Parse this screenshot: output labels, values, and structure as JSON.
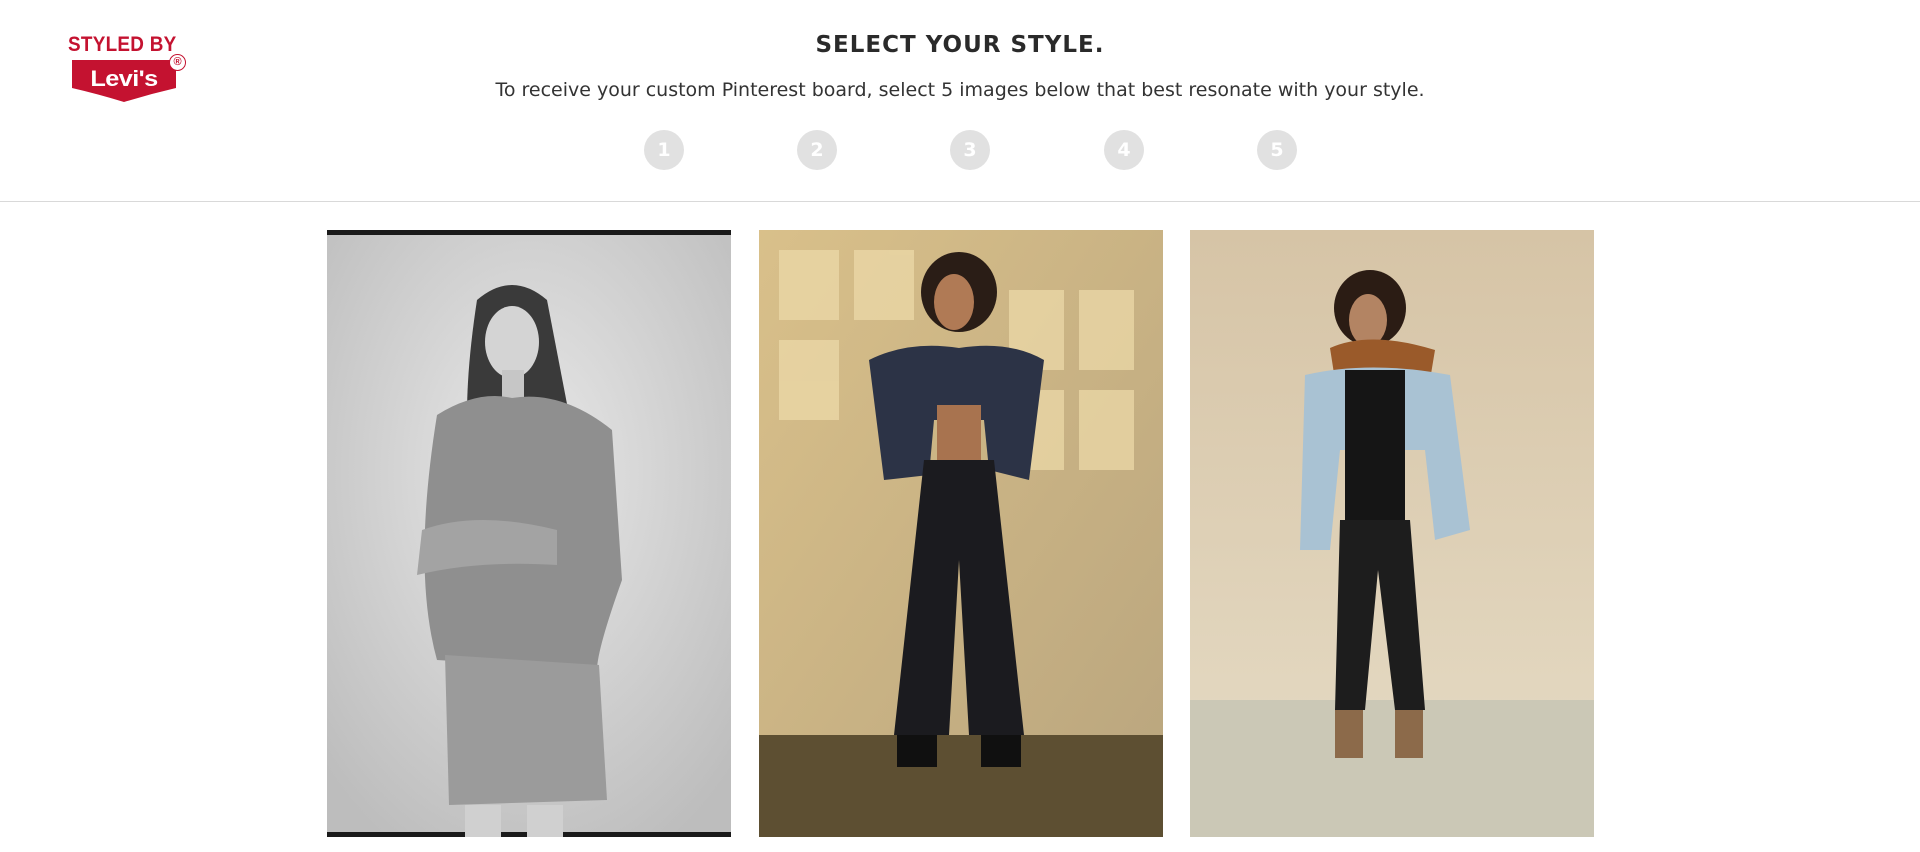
{
  "brand": {
    "styled_by": "STYLED BY",
    "name": "Levi's",
    "registered": "®",
    "color": "#c41230"
  },
  "header": {
    "title": "SELECT YOUR STYLE.",
    "subtitle": "To receive your custom Pinterest board, select 5 images below that best resonate with your style."
  },
  "steps": [
    {
      "label": "1"
    },
    {
      "label": "2"
    },
    {
      "label": "3"
    },
    {
      "label": "4"
    },
    {
      "label": "5"
    }
  ],
  "colors": {
    "step_inactive": "#e1e1e1",
    "divider": "#d9d9d9"
  }
}
